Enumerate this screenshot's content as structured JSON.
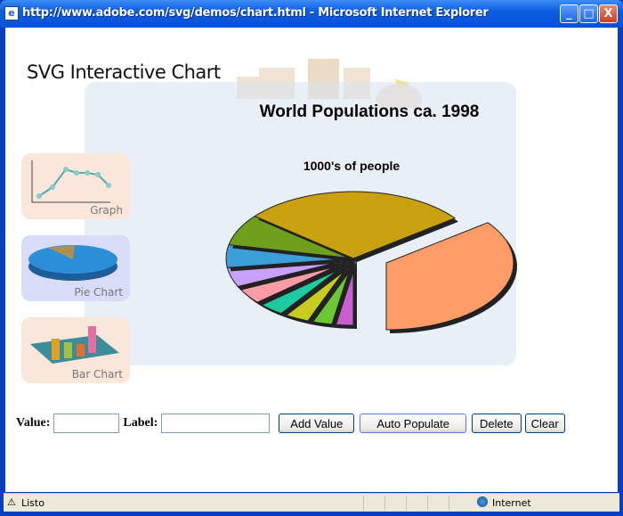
{
  "window": {
    "title": "http://www.adobe.com/svg/demos/chart.html - Microsoft Internet Explorer",
    "minimize": "_",
    "maximize": "□",
    "close": "X"
  },
  "page": {
    "app_title": "SVG Interactive Chart",
    "thumbnails": [
      {
        "label": "Graph",
        "icon": "line-graph-icon"
      },
      {
        "label": "Pie Chart",
        "icon": "pie-chart-icon"
      },
      {
        "label": "Bar Chart",
        "icon": "bar-chart-icon"
      }
    ],
    "form": {
      "value_label": "Value:",
      "value": "",
      "label_label": "Label:",
      "label": "",
      "add_value": "Add Value",
      "auto_populate": "Auto Populate",
      "delete": "Delete",
      "clear": "Clear"
    }
  },
  "chart_data": {
    "type": "pie",
    "title": "World Populations ca. 1998",
    "subtitle": "1000's of people",
    "values": [
      2.7,
      3.1,
      3.8,
      4.0,
      4.5,
      4.7,
      5.5,
      7.6,
      28.8,
      35.3
    ],
    "colors": [
      "#c85ecf",
      "#6cc832",
      "#c8cc1e",
      "#1ccca0",
      "#ff9ca8",
      "#c8a0ff",
      "#3ca0d8",
      "#6ea01e",
      "#c8a010",
      "#ff9c68"
    ],
    "exploded_index": 9,
    "legend": "none"
  },
  "status": {
    "text": "Listo",
    "zone": "Internet"
  }
}
